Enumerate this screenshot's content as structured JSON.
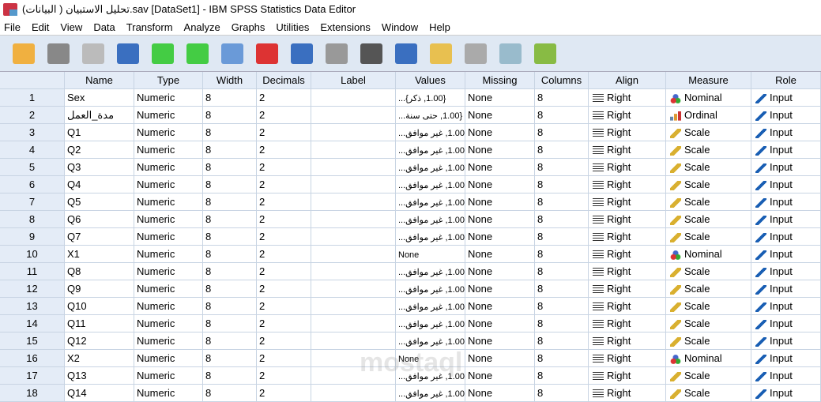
{
  "title": "تحليل الاستبيان ( البيانات).sav [DataSet1] - IBM SPSS Statistics Data Editor",
  "menu": [
    "File",
    "Edit",
    "View",
    "Data",
    "Transform",
    "Analyze",
    "Graphs",
    "Utilities",
    "Extensions",
    "Window",
    "Help"
  ],
  "toolbar": [
    {
      "name": "open-icon",
      "color": "#f0b040"
    },
    {
      "name": "save-icon",
      "color": "#888"
    },
    {
      "name": "print-icon",
      "color": "#bbb"
    },
    {
      "name": "recall-dialog-icon",
      "color": "#3a6fc0"
    },
    {
      "name": "undo-icon",
      "color": "#4c4"
    },
    {
      "name": "redo-icon",
      "color": "#4c4"
    },
    {
      "name": "goto-case-icon",
      "color": "#6a9ad8"
    },
    {
      "name": "goto-variable-icon",
      "color": "#d33"
    },
    {
      "name": "variables-icon",
      "color": "#3a6fc0"
    },
    {
      "name": "run-descriptives-icon",
      "color": "#999"
    },
    {
      "name": "find-icon",
      "color": "#555"
    },
    {
      "name": "insert-cases-icon",
      "color": "#3a6fc0"
    },
    {
      "name": "insert-variable-icon",
      "color": "#e8c050"
    },
    {
      "name": "split-file-icon",
      "color": "#aaa"
    },
    {
      "name": "weight-cases-icon",
      "color": "#9bc"
    },
    {
      "name": "value-labels-icon",
      "color": "#8b4"
    }
  ],
  "headers": [
    "Name",
    "Type",
    "Width",
    "Decimals",
    "Label",
    "Values",
    "Missing",
    "Columns",
    "Align",
    "Measure",
    "Role"
  ],
  "rows": [
    {
      "n": "1",
      "name": "Sex",
      "type": "Numeric",
      "width": "8",
      "dec": "2",
      "label": "",
      "values": "{1.00, ذكر}...",
      "missing": "None",
      "cols": "8",
      "align": "Right",
      "measure": "Nominal",
      "role": "Input"
    },
    {
      "n": "2",
      "name": "مدة_العمل",
      "type": "Numeric",
      "width": "8",
      "dec": "2",
      "label": "",
      "values": "{1.00, حتى سنة...",
      "missing": "None",
      "cols": "8",
      "align": "Right",
      "measure": "Ordinal",
      "role": "Input"
    },
    {
      "n": "3",
      "name": "Q1",
      "type": "Numeric",
      "width": "8",
      "dec": "2",
      "label": "",
      "values": "{1.00, غير موافق...",
      "missing": "None",
      "cols": "8",
      "align": "Right",
      "measure": "Scale",
      "role": "Input"
    },
    {
      "n": "4",
      "name": "Q2",
      "type": "Numeric",
      "width": "8",
      "dec": "2",
      "label": "",
      "values": "{1.00, غير موافق...",
      "missing": "None",
      "cols": "8",
      "align": "Right",
      "measure": "Scale",
      "role": "Input"
    },
    {
      "n": "5",
      "name": "Q3",
      "type": "Numeric",
      "width": "8",
      "dec": "2",
      "label": "",
      "values": "{1.00, غير موافق...",
      "missing": "None",
      "cols": "8",
      "align": "Right",
      "measure": "Scale",
      "role": "Input"
    },
    {
      "n": "6",
      "name": "Q4",
      "type": "Numeric",
      "width": "8",
      "dec": "2",
      "label": "",
      "values": "{1.00, غير موافق...",
      "missing": "None",
      "cols": "8",
      "align": "Right",
      "measure": "Scale",
      "role": "Input"
    },
    {
      "n": "7",
      "name": "Q5",
      "type": "Numeric",
      "width": "8",
      "dec": "2",
      "label": "",
      "values": "{1.00, غير موافق...",
      "missing": "None",
      "cols": "8",
      "align": "Right",
      "measure": "Scale",
      "role": "Input"
    },
    {
      "n": "8",
      "name": "Q6",
      "type": "Numeric",
      "width": "8",
      "dec": "2",
      "label": "",
      "values": "{1.00, غير موافق...",
      "missing": "None",
      "cols": "8",
      "align": "Right",
      "measure": "Scale",
      "role": "Input"
    },
    {
      "n": "9",
      "name": "Q7",
      "type": "Numeric",
      "width": "8",
      "dec": "2",
      "label": "",
      "values": "{1.00, غير موافق...",
      "missing": "None",
      "cols": "8",
      "align": "Right",
      "measure": "Scale",
      "role": "Input"
    },
    {
      "n": "10",
      "name": "X1",
      "type": "Numeric",
      "width": "8",
      "dec": "2",
      "label": "",
      "values": "None",
      "missing": "None",
      "cols": "8",
      "align": "Right",
      "measure": "Nominal",
      "role": "Input"
    },
    {
      "n": "11",
      "name": "Q8",
      "type": "Numeric",
      "width": "8",
      "dec": "2",
      "label": "",
      "values": "{1.00, غير موافق...",
      "missing": "None",
      "cols": "8",
      "align": "Right",
      "measure": "Scale",
      "role": "Input"
    },
    {
      "n": "12",
      "name": "Q9",
      "type": "Numeric",
      "width": "8",
      "dec": "2",
      "label": "",
      "values": "{1.00, غير موافق...",
      "missing": "None",
      "cols": "8",
      "align": "Right",
      "measure": "Scale",
      "role": "Input"
    },
    {
      "n": "13",
      "name": "Q10",
      "type": "Numeric",
      "width": "8",
      "dec": "2",
      "label": "",
      "values": "{1.00, غير موافق...",
      "missing": "None",
      "cols": "8",
      "align": "Right",
      "measure": "Scale",
      "role": "Input"
    },
    {
      "n": "14",
      "name": "Q11",
      "type": "Numeric",
      "width": "8",
      "dec": "2",
      "label": "",
      "values": "{1.00, غير موافق...",
      "missing": "None",
      "cols": "8",
      "align": "Right",
      "measure": "Scale",
      "role": "Input"
    },
    {
      "n": "15",
      "name": "Q12",
      "type": "Numeric",
      "width": "8",
      "dec": "2",
      "label": "",
      "values": "{1.00, غير موافق...",
      "missing": "None",
      "cols": "8",
      "align": "Right",
      "measure": "Scale",
      "role": "Input"
    },
    {
      "n": "16",
      "name": "X2",
      "type": "Numeric",
      "width": "8",
      "dec": "2",
      "label": "",
      "values": "None",
      "missing": "None",
      "cols": "8",
      "align": "Right",
      "measure": "Nominal",
      "role": "Input"
    },
    {
      "n": "17",
      "name": "Q13",
      "type": "Numeric",
      "width": "8",
      "dec": "2",
      "label": "",
      "values": "{1.00, غير موافق...",
      "missing": "None",
      "cols": "8",
      "align": "Right",
      "measure": "Scale",
      "role": "Input"
    },
    {
      "n": "18",
      "name": "Q14",
      "type": "Numeric",
      "width": "8",
      "dec": "2",
      "label": "",
      "values": "{1.00, غير موافق...",
      "missing": "None",
      "cols": "8",
      "align": "Right",
      "measure": "Scale",
      "role": "Input"
    }
  ],
  "watermark": "مستقل mostaql.com"
}
